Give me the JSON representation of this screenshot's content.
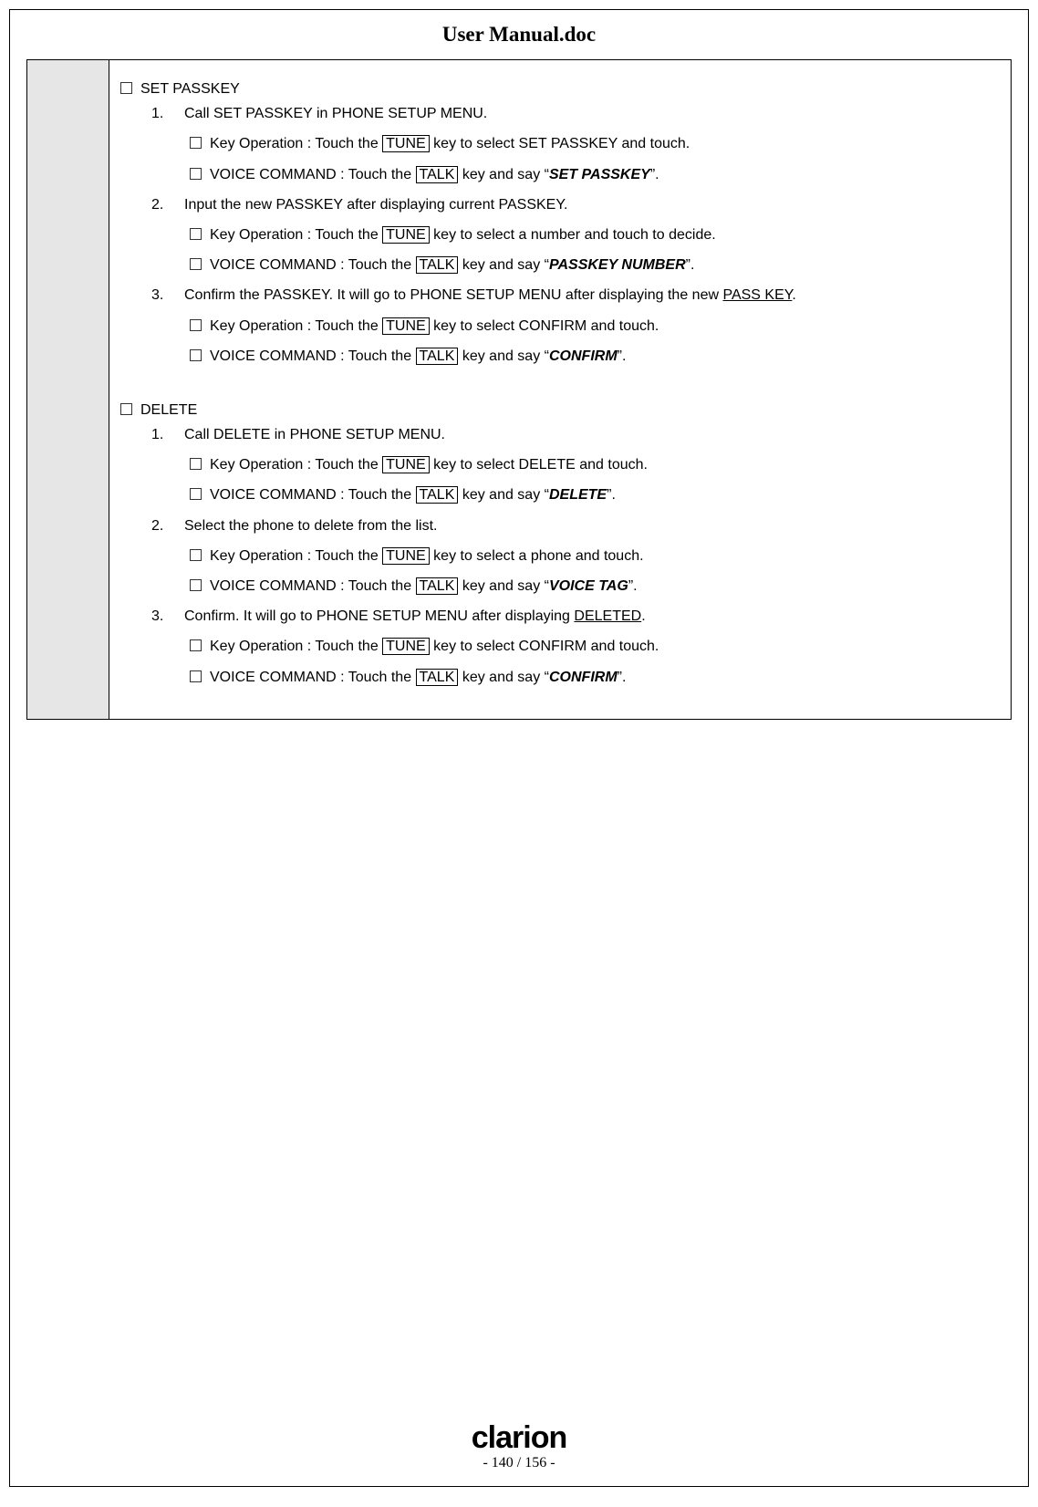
{
  "title": "User Manual.doc",
  "brand": "clarion",
  "page_indicator": "- 140 / 156 -",
  "keys": {
    "tune": "TUNE",
    "talk": "TALK"
  },
  "labels": {
    "key_op": "Key Operation  :  Touch the ",
    "voice_cmd": "VOICE COMMAND  :  Touch the "
  },
  "sections": [
    {
      "title": "SET PASSKEY",
      "steps": [
        {
          "n": "1.",
          "text": "Call SET PASSKEY in PHONE SETUP MENU.",
          "key_tail": " key to select SET PASSKEY and touch.",
          "voice_tail_pre": " key and say “",
          "voice_word": "SET PASSKEY",
          "voice_tail_post": "”."
        },
        {
          "n": "2.",
          "text": "Input the new PASSKEY after displaying current PASSKEY.",
          "key_tail": " key to select a number and touch to decide.",
          "voice_tail_pre": " key and say “",
          "voice_word": "PASSKEY  NUMBER",
          "voice_tail_post": "”."
        },
        {
          "n": "3.",
          "text_pre": "Confirm the PASSKEY. It will go to PHONE SETUP MENU after displaying the new ",
          "text_ul": "PASS KEY",
          "text_post": ".",
          "key_tail": " key to select CONFIRM and touch.",
          "voice_tail_pre": " key and say “",
          "voice_word": "CONFIRM",
          "voice_tail_post": "”."
        }
      ]
    },
    {
      "title": "DELETE",
      "steps": [
        {
          "n": "1.",
          "text": "Call DELETE in PHONE SETUP MENU.",
          "key_tail": " key to select DELETE and touch.",
          "voice_tail_pre": " key and say “",
          "voice_word": "DELETE",
          "voice_tail_post": "”."
        },
        {
          "n": "2.",
          "text": "Select the phone to delete from the list.",
          "key_tail": " key to select a phone and touch.",
          "voice_tail_pre": " key and say “",
          "voice_word": "VOICE TAG",
          "voice_tail_post": "”."
        },
        {
          "n": "3.",
          "text_pre": "Confirm. It will go to PHONE SETUP MENU after displaying ",
          "text_ul": "DELETED",
          "text_post": ".",
          "key_tail": " key to select CONFIRM and touch.",
          "voice_tail_pre": " key and say “",
          "voice_word": "CONFIRM",
          "voice_tail_post": "”."
        }
      ]
    }
  ]
}
